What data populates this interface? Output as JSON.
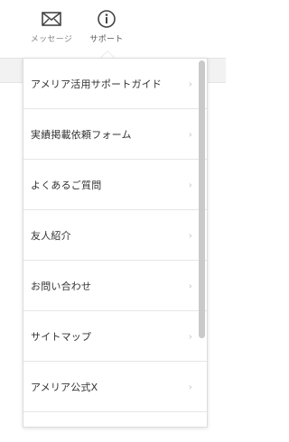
{
  "header": {
    "message_label": "メッセージ",
    "support_label": "サポート"
  },
  "menu": {
    "items": [
      {
        "label": "アメリア活用サポートガイド"
      },
      {
        "label": "実績掲載依頼フォーム"
      },
      {
        "label": "よくあるご質問"
      },
      {
        "label": "友人紹介"
      },
      {
        "label": "お問い合わせ"
      },
      {
        "label": "サイトマップ"
      },
      {
        "label": "アメリア公式X"
      }
    ],
    "chevron": "›"
  },
  "colors": {
    "text": "#333333",
    "muted": "#888888",
    "divider": "#e6e6e6",
    "scrollbar": "#c9c9c9"
  }
}
